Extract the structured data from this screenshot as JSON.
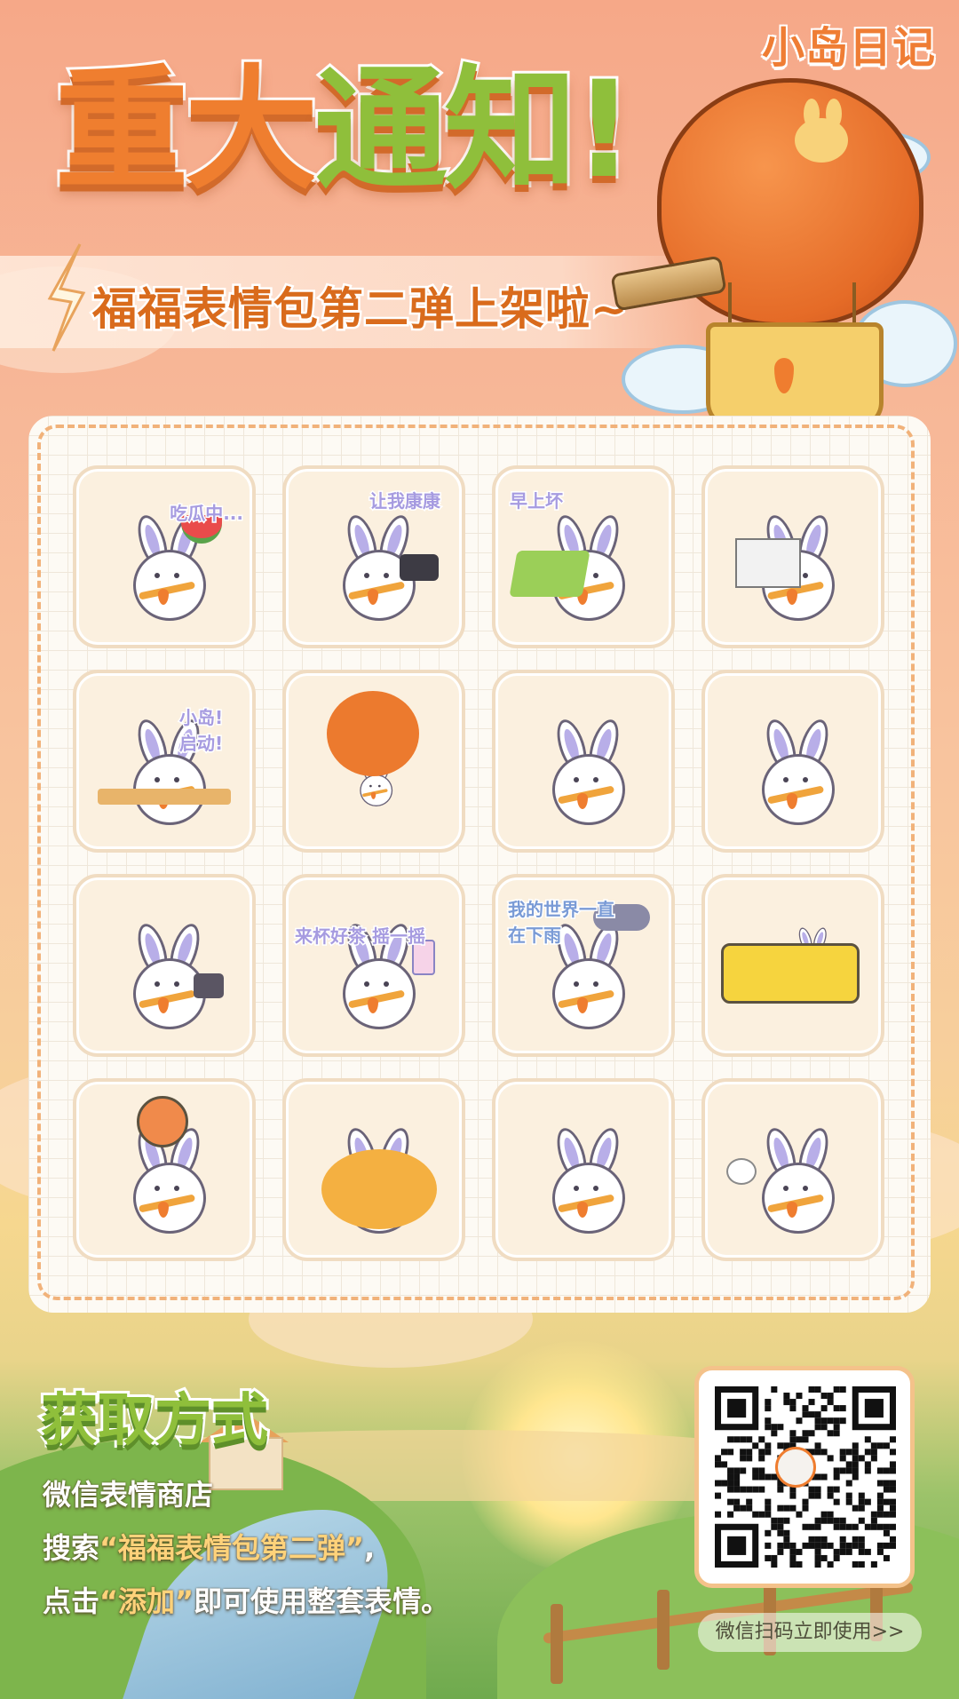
{
  "logo": {
    "text": "小岛日记"
  },
  "header": {
    "title_part1": "重大",
    "title_part2": "通知!",
    "subtitle": "福福表情包第二弹上架啦~"
  },
  "stickers": [
    {
      "caption": "吃瓜中...",
      "prop": "watermelon"
    },
    {
      "caption": "让我康康",
      "prop": "camera"
    },
    {
      "caption": "早上坏",
      "prop": "laptop"
    },
    {
      "caption": "",
      "prop": "newspaper"
    },
    {
      "caption": "小岛!启动!",
      "prop": "laptop-desk"
    },
    {
      "caption": "",
      "prop": "hot-air-balloon"
    },
    {
      "caption": "",
      "prop": "none"
    },
    {
      "caption": "",
      "prop": "none"
    },
    {
      "caption": "",
      "prop": "phone"
    },
    {
      "caption": "来杯好茶 摇一摇",
      "prop": "drink"
    },
    {
      "caption": "我的世界一直在下雨",
      "prop": "rain-cloud"
    },
    {
      "caption": "",
      "prop": "truck"
    },
    {
      "caption": "",
      "prop": "ball"
    },
    {
      "caption": "",
      "prop": "lounge"
    },
    {
      "caption": "",
      "prop": "back-view"
    },
    {
      "caption": "",
      "prop": "puff"
    }
  ],
  "access": {
    "title": "获取方式",
    "line1": "微信表情商店",
    "line2_prefix": "搜索",
    "line2_highlight": "“福福表情包第二弹”",
    "line2_suffix": ",",
    "line3_prefix": "点击",
    "line3_highlight": "“添加”",
    "line3_suffix": "即可使用整套表情。"
  },
  "qr": {
    "button_label": "微信扫码立即使用>>"
  },
  "colors": {
    "accent_orange": "#ef7e2f",
    "accent_green": "#8fbf3b",
    "panel_border": "#f1b27a"
  }
}
